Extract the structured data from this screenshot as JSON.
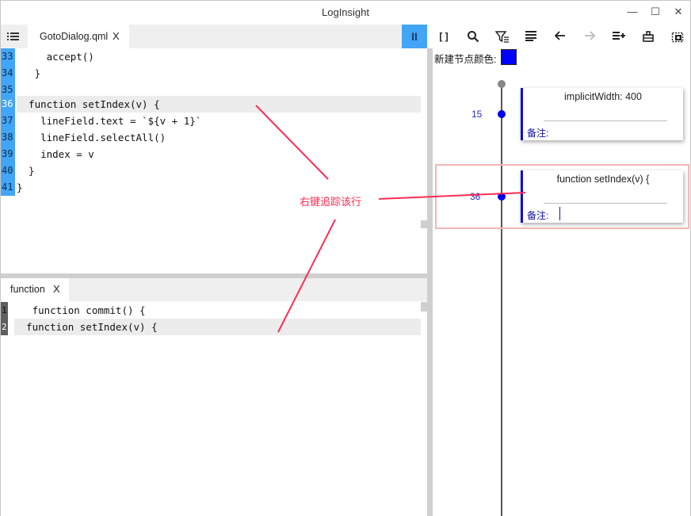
{
  "app": {
    "title": "LogInsight"
  },
  "window_controls": {
    "minimize": "—",
    "maximize": "☐",
    "close": "✕"
  },
  "editor_tabs": [
    {
      "label": "GotoDialog.qml",
      "close": "X"
    }
  ],
  "pause_button": {
    "label": "II"
  },
  "toolbar": {
    "bracket_label": "[ ]",
    "icons": [
      "search-icon",
      "filter-icon",
      "align-icon",
      "back-arrow-icon",
      "forward-arrow-icon",
      "add-list-icon",
      "plugin-icon",
      "screenshot-icon"
    ]
  },
  "editor": {
    "lines": [
      {
        "num": "33",
        "text": "     accept()"
      },
      {
        "num": "34",
        "text": "   }"
      },
      {
        "num": "35",
        "text": ""
      },
      {
        "num": "36",
        "text": "  function setIndex(v) {"
      },
      {
        "num": "37",
        "text": "    lineField.text = `${v + 1}`"
      },
      {
        "num": "38",
        "text": "    lineField.selectAll()"
      },
      {
        "num": "39",
        "text": "    index = v"
      },
      {
        "num": "40",
        "text": "  }"
      },
      {
        "num": "41",
        "text": "}"
      }
    ],
    "highlighted_line": "36"
  },
  "search_tab": {
    "label": "function",
    "close": "X"
  },
  "search_results": [
    {
      "num": "1",
      "text": "   function commit() {"
    },
    {
      "num": "2",
      "text": "  function setIndex(v) {"
    }
  ],
  "trace_panel": {
    "new_node_color_label": "新建节点颜色:",
    "node_color": "#0000ff",
    "nodes": [
      {
        "line": "15",
        "text": "implicitWidth: 400",
        "note_label": "备注:"
      },
      {
        "line": "36",
        "text": "function setIndex(v) {",
        "note_label": "备注:"
      }
    ]
  },
  "annotation": {
    "text": "右键追踪该行",
    "color": "#ff2d55"
  },
  "colors": {
    "accent": "#42a5f5",
    "gutter_dark": "#5f5f5f",
    "node_border": "#1010cc",
    "highlight_frame": "#f5b5b5"
  }
}
